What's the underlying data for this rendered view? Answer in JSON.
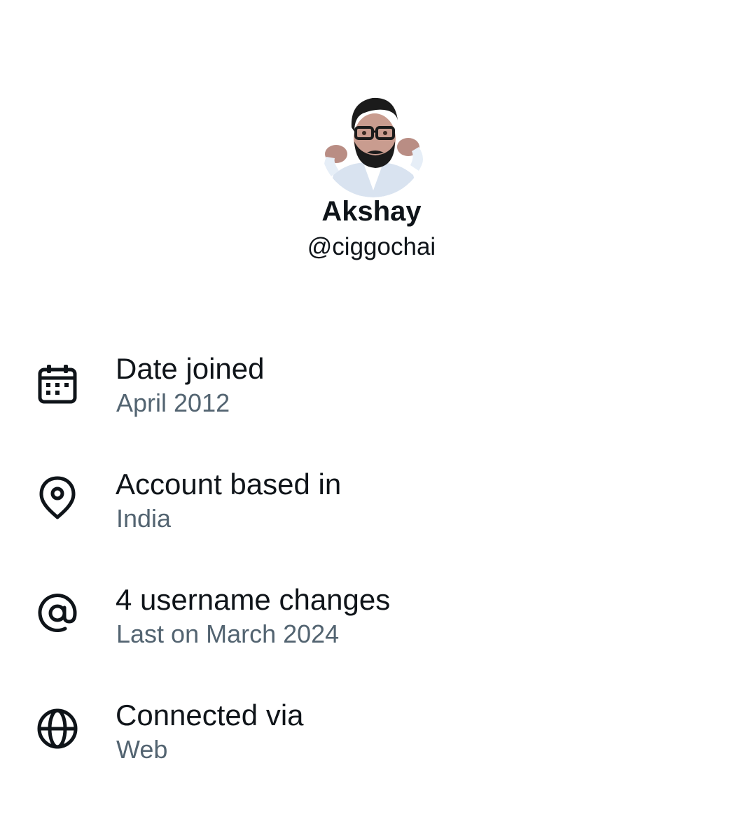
{
  "profile": {
    "display_name": "Akshay",
    "handle": "@ciggochai"
  },
  "info": [
    {
      "icon": "calendar-icon",
      "title": "Date joined",
      "subtitle": "April 2012"
    },
    {
      "icon": "location-pin-icon",
      "title": "Account based in",
      "subtitle": "India"
    },
    {
      "icon": "at-sign-icon",
      "title": "4 username changes",
      "subtitle": "Last on March 2024"
    },
    {
      "icon": "globe-icon",
      "title": "Connected via",
      "subtitle": "Web"
    }
  ],
  "colors": {
    "text_primary": "#0f1419",
    "text_secondary": "#536471",
    "background": "#ffffff"
  }
}
